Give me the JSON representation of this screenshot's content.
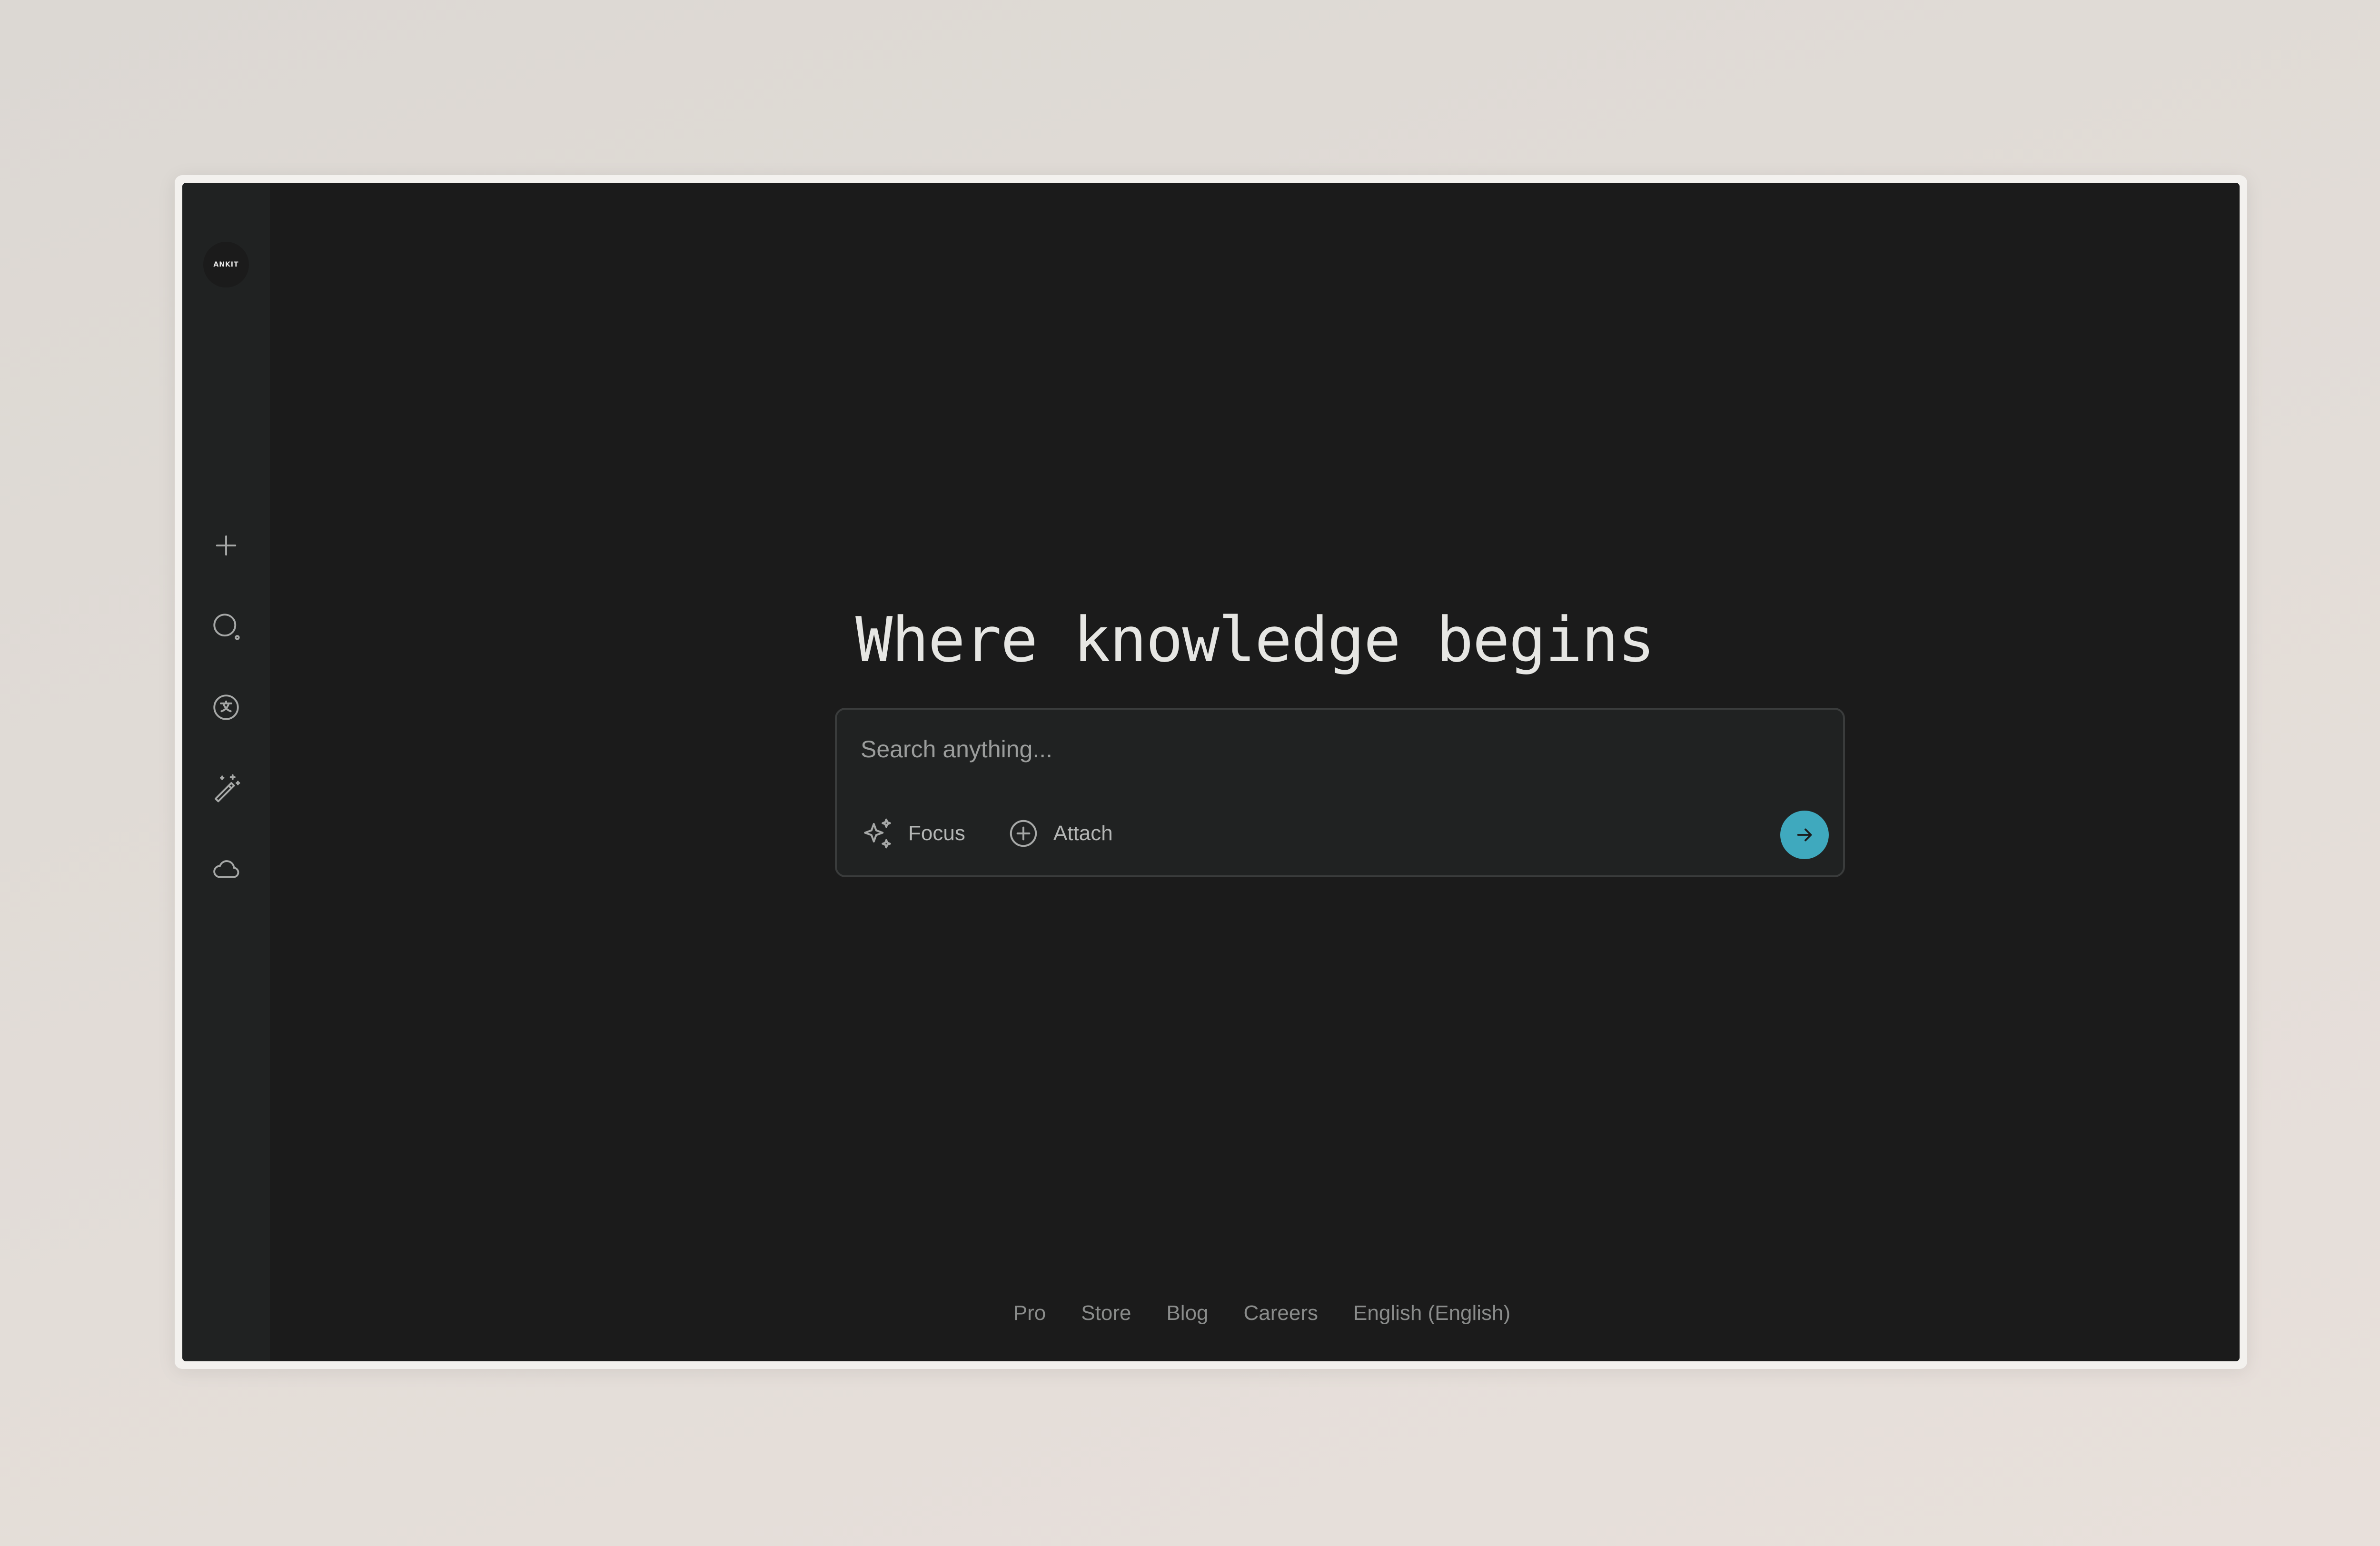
{
  "sidebar": {
    "logo_text": "ANKIT",
    "icons": [
      "plus-icon",
      "search-icon",
      "translate-icon",
      "magic-wand-icon",
      "cloud-icon"
    ],
    "expand_icon": "chevron-right-icon"
  },
  "main": {
    "headline": "Where knowledge begins",
    "search": {
      "placeholder": "Search anything...",
      "focus_label": "Focus",
      "attach_label": "Attach",
      "submit_icon": "arrow-right-icon"
    }
  },
  "footer": {
    "links": [
      "Pro",
      "Store",
      "Blog",
      "Careers",
      "English (English)"
    ]
  },
  "colors": {
    "background": "#1b1b1b",
    "sidebar": "#202222",
    "accent": "#3fa9be",
    "text": "#e6e6e3",
    "muted": "#8a8c8b"
  }
}
